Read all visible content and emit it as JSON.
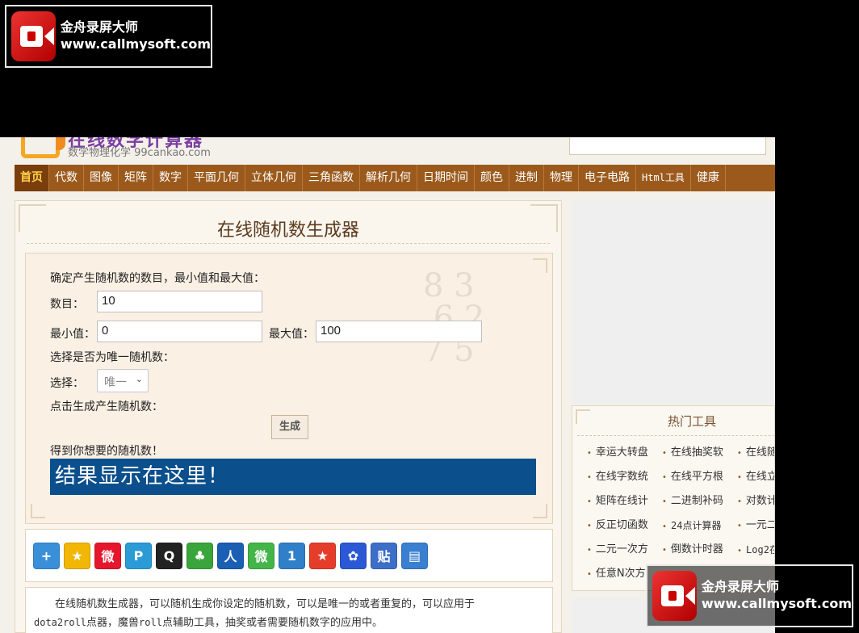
{
  "site": {
    "logo_title": "在线数学计算器",
    "logo_sub": "数学物理化学 99cankao.com"
  },
  "nav": [
    {
      "label": "首页",
      "active": true
    },
    {
      "label": "代数"
    },
    {
      "label": "图像"
    },
    {
      "label": "矩阵"
    },
    {
      "label": "数字"
    },
    {
      "label": "平面几何"
    },
    {
      "label": "立体几何"
    },
    {
      "label": "三角函数"
    },
    {
      "label": "解析几何"
    },
    {
      "label": "日期时间"
    },
    {
      "label": "颜色"
    },
    {
      "label": "进制"
    },
    {
      "label": "物理"
    },
    {
      "label": "电子电路"
    },
    {
      "label": "Html工具"
    },
    {
      "label": "健康"
    }
  ],
  "main": {
    "title": "在线随机数生成器",
    "instruction": "确定产生随机数的数目，最小值和最大值：",
    "count_label": "数目：",
    "count_value": "10",
    "min_label": "最小值：",
    "min_value": "0",
    "max_label": "最大值：",
    "max_value": "100",
    "unique_prompt": "选择是否为唯一随机数：",
    "select_label": "选择：",
    "select_value": "唯一",
    "generate_prompt": "点击生成产生随机数：",
    "generate_button": "生成",
    "result_label": "得到你想要的随机数！",
    "result_text": "结果显示在这里！"
  },
  "share_icons": [
    {
      "name": "add-share-icon",
      "glyph": "+",
      "color": "#3a8fd9"
    },
    {
      "name": "qzone-icon",
      "glyph": "★",
      "color": "#f2b705"
    },
    {
      "name": "weibo-icon",
      "glyph": "微",
      "color": "#e6162d"
    },
    {
      "name": "tencent-weibo-icon",
      "glyph": "P",
      "color": "#2a9bd6"
    },
    {
      "name": "qq-icon",
      "glyph": "Q",
      "color": "#222222"
    },
    {
      "name": "kaixin-icon",
      "glyph": "♣",
      "color": "#3aa53a"
    },
    {
      "name": "renren-icon",
      "glyph": "人",
      "color": "#1a5fb4"
    },
    {
      "name": "wechat-icon",
      "glyph": "微",
      "color": "#44b549"
    },
    {
      "name": "douban-icon",
      "glyph": "1",
      "color": "#2f7fc9"
    },
    {
      "name": "star-icon",
      "glyph": "★",
      "color": "#e63d2b"
    },
    {
      "name": "baidu-icon",
      "glyph": "✿",
      "color": "#2b59d6"
    },
    {
      "name": "tieba-icon",
      "glyph": "贴",
      "color": "#3d6fc8"
    },
    {
      "name": "print-icon",
      "glyph": "▤",
      "color": "#3a7fd0"
    }
  ],
  "description": {
    "line1": "在线随机数生成器，可以随机生成你设定的随机数，可以是唯一的或者重复的，可以应用于",
    "line2_mono": "dota2roll",
    "line2_a": "点器，魔兽",
    "line2_mono2": "roll",
    "line2_b": "点辅助工具，抽奖或者需要随机数字的应用中。"
  },
  "hot_tools": {
    "title": "热门工具",
    "items": [
      "幸运大转盘",
      "在线抽奖软",
      "在线随",
      "在线字数统",
      "在线平方根",
      "在线立",
      "矩阵在线计",
      "二进制补码",
      "对数计",
      "反正切函数",
      "24点计算器",
      "一元二",
      "二元一次方",
      "倒数计时器",
      "Log2在",
      "任意N次方"
    ]
  },
  "watermark": {
    "name": "金舟录屏大师",
    "url": "www.callmysoft.com"
  }
}
